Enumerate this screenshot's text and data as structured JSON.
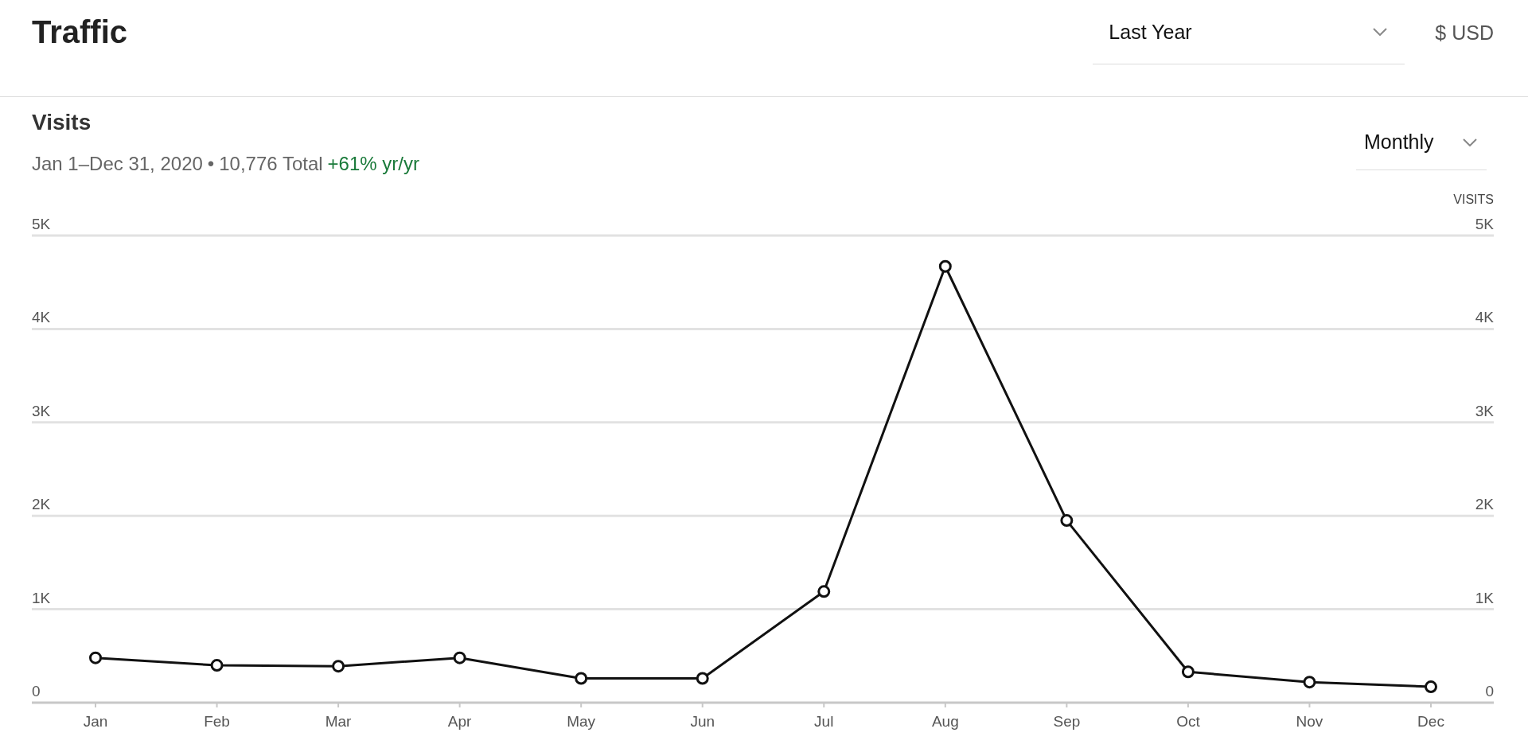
{
  "header": {
    "title": "Traffic",
    "period_dropdown": "Last Year",
    "currency": "$ USD"
  },
  "visits": {
    "title": "Visits",
    "date_range": "Jan 1–Dec 31, 2020",
    "separator": "•",
    "total": "10,776 Total",
    "change": "+61% yr/yr",
    "interval_dropdown": "Monthly",
    "axis_caption": "VISITS",
    "chart_data": {
      "type": "line",
      "categories": [
        "Jan",
        "Feb",
        "Mar",
        "Apr",
        "May",
        "Jun",
        "Jul",
        "Aug",
        "Sep",
        "Oct",
        "Nov",
        "Dec"
      ],
      "ylim": [
        0,
        5000
      ],
      "grid": true,
      "yticks": [
        {
          "value": 0,
          "label": "0"
        },
        {
          "value": 1000,
          "label": "1K"
        },
        {
          "value": 2000,
          "label": "2K"
        },
        {
          "value": 3000,
          "label": "3K"
        },
        {
          "value": 4000,
          "label": "4K"
        },
        {
          "value": 5000,
          "label": "5K"
        }
      ],
      "series": [
        {
          "color": "#111111",
          "marker": true,
          "values": [
            480,
            400,
            390,
            480,
            260,
            260,
            1190,
            4670,
            1950,
            330,
            220,
            170
          ]
        }
      ]
    }
  }
}
